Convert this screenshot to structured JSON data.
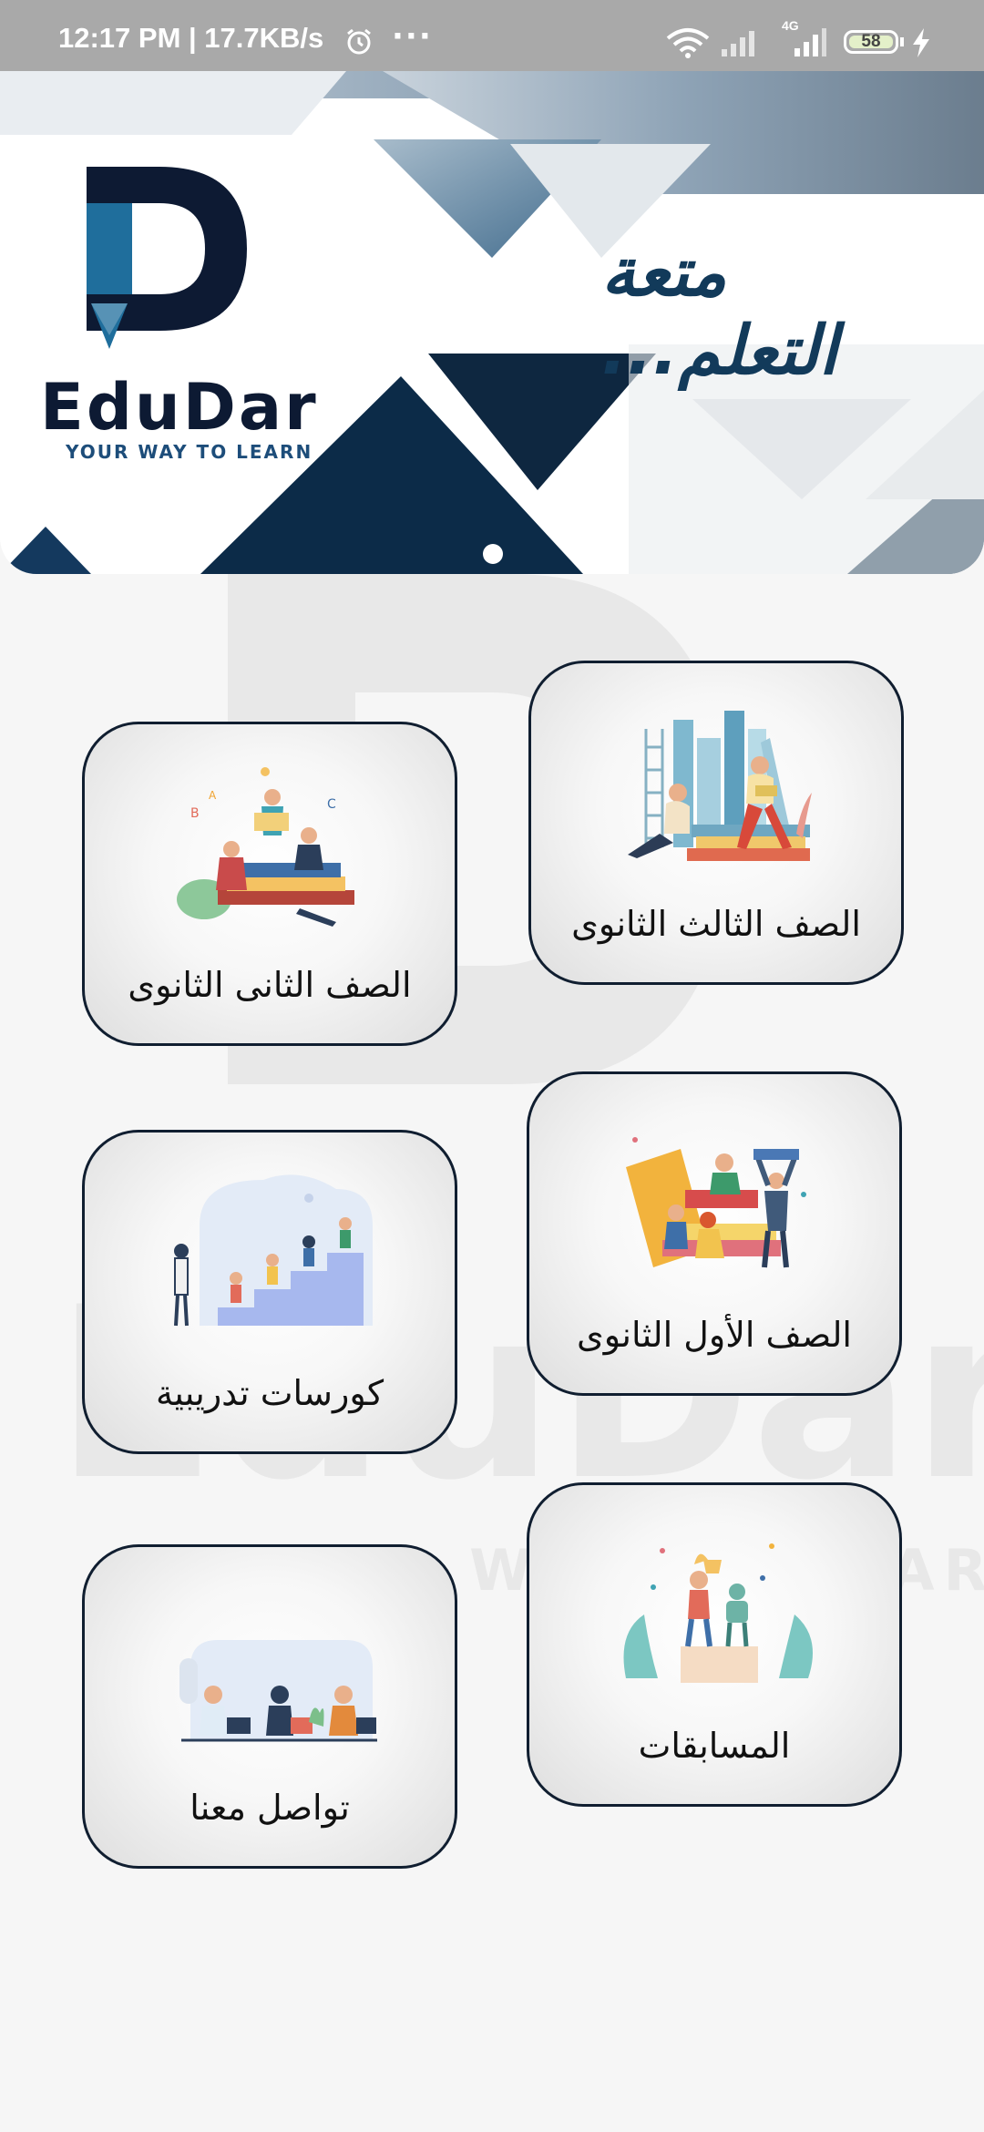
{
  "status_bar": {
    "time_speed": "12:17 PM | 17.7KB/s",
    "more": "···",
    "network": "4G",
    "battery": "58"
  },
  "banner": {
    "logo_name": "EduDar",
    "logo_tagline": "YOUR WAY TO LEARN",
    "slogan": "متعة التعلم..."
  },
  "watermark": {
    "name": "EduDar",
    "tagline": "YOUR WAY TO LEARN"
  },
  "cards": {
    "third_secondary": "الصف الثالث الثانوى",
    "second_secondary": "الصف الثانى الثانوى",
    "first_secondary": "الصف الأول الثانوى",
    "training_courses": "كورسات تدريبية",
    "competitions": "المسابقات",
    "contact_us": "تواصل معنا"
  },
  "colors": {
    "brand_navy": "#0d1a33",
    "brand_blue": "#1f6e9c",
    "status_bar": "#a9a9a9",
    "card_border": "#101e30"
  }
}
